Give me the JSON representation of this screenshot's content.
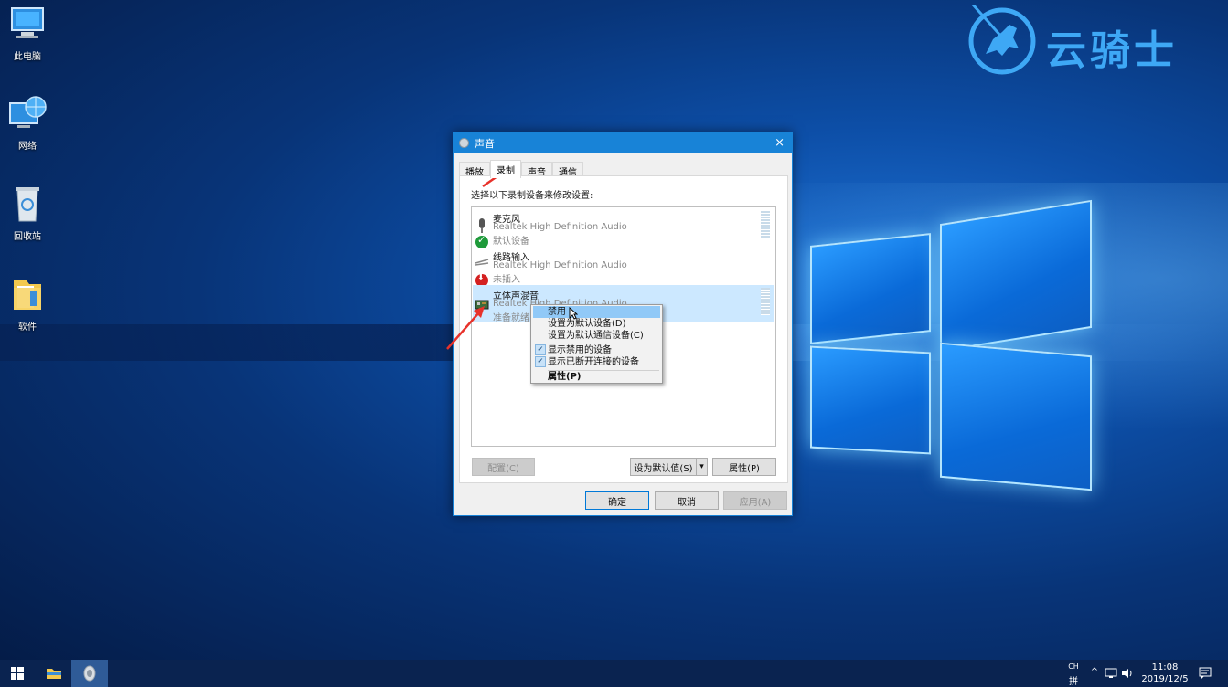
{
  "desktop": {
    "icons": [
      {
        "label": "此电脑"
      },
      {
        "label": "网络"
      },
      {
        "label": "回收站"
      },
      {
        "label": "软件"
      }
    ]
  },
  "watermark": {
    "text": "云骑士"
  },
  "dialog": {
    "title": "声音",
    "close": "×",
    "tabs": [
      "播放",
      "录制",
      "声音",
      "通信"
    ],
    "active_tab": "录制",
    "instruction": "选择以下录制设备来修改设置:",
    "devices": [
      {
        "name": "麦克风",
        "driver": "Realtek High Definition Audio",
        "status": "默认设备",
        "selected": false
      },
      {
        "name": "线路输入",
        "driver": "Realtek High Definition Audio",
        "status": "未插入",
        "selected": false
      },
      {
        "name": "立体声混音",
        "driver": "Realtek High Definition Audio",
        "status": "准备就绪",
        "selected": true
      }
    ],
    "buttons": {
      "configure": "配置(C)",
      "set_default": "设为默认值(S)",
      "dropdown": "▾",
      "properties": "属性(P)",
      "ok": "确定",
      "cancel": "取消",
      "apply": "应用(A)"
    }
  },
  "context_menu": {
    "items": [
      {
        "label": "禁用",
        "highlighted": true
      },
      {
        "label": "设置为默认设备(D)"
      },
      {
        "label": "设置为默认通信设备(C)"
      },
      {
        "label": "显示禁用的设备",
        "checked": true
      },
      {
        "label": "显示已断开连接的设备",
        "checked": true
      },
      {
        "label": "属性(P)",
        "bold": true
      }
    ]
  },
  "taskbar": {
    "ime_top": "CH",
    "ime_bottom": "拼",
    "chevron": "^",
    "time": "11:08",
    "date": "2019/12/5"
  },
  "colors": {
    "titlebar": "#1883d7",
    "selection": "#cce8ff",
    "menu_highlight": "#91c9f7",
    "arrow": "#e8322b",
    "taskbar": "#0a2350"
  }
}
